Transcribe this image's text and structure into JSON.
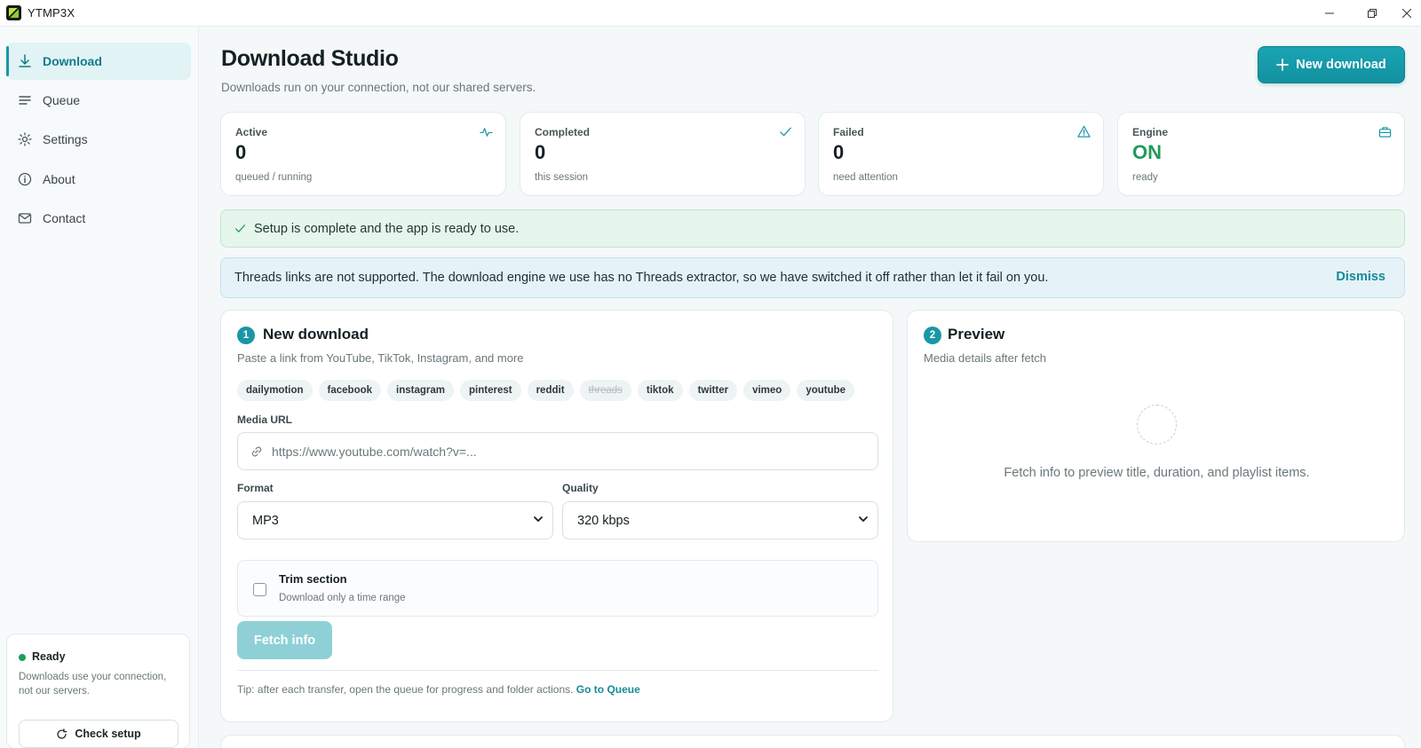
{
  "window": {
    "title": "YTMP3X"
  },
  "sidebar": {
    "items": [
      {
        "label": "Download",
        "icon": "download-icon",
        "active": true
      },
      {
        "label": "Queue",
        "icon": "list-icon"
      },
      {
        "label": "Settings",
        "icon": "gear-icon"
      },
      {
        "label": "About",
        "icon": "info-icon"
      },
      {
        "label": "Contact",
        "icon": "mail-icon"
      }
    ],
    "status": {
      "title": "Ready",
      "text": "Downloads use your connection, not our servers.",
      "button": "Check setup"
    }
  },
  "header": {
    "title": "Download Studio",
    "subtitle": "Downloads run on your connection, not our shared servers.",
    "new_download": "New download"
  },
  "stats": [
    {
      "label": "Active",
      "value": "0",
      "note": "queued / running",
      "icon": "activity-icon"
    },
    {
      "label": "Completed",
      "value": "0",
      "note": "this session",
      "icon": "check-icon"
    },
    {
      "label": "Failed",
      "value": "0",
      "note": "need attention",
      "icon": "warning-icon"
    },
    {
      "label": "Engine",
      "value": "ON",
      "note": "ready",
      "icon": "briefcase-icon"
    }
  ],
  "alerts": {
    "success": "Setup is complete and the app is ready to use.",
    "info": "Threads links are not supported. The download engine we use has no Threads extractor, so we have switched it off rather than let it fail on you.",
    "dismiss": "Dismiss"
  },
  "new_download": {
    "step": "1",
    "title": "New download",
    "subtitle": "Paste a link from YouTube, TikTok, Instagram, and more",
    "platforms": [
      "dailymotion",
      "facebook",
      "instagram",
      "pinterest",
      "reddit",
      "threads",
      "tiktok",
      "twitter",
      "vimeo",
      "youtube"
    ],
    "url_label": "Media URL",
    "url_placeholder": "https://www.youtube.com/watch?v=...",
    "format_label": "Format",
    "format_value": "MP3",
    "quality_label": "Quality",
    "quality_value": "320 kbps",
    "trim_title": "Trim section",
    "trim_sub": "Download only a time range",
    "fetch": "Fetch info",
    "tip": "Tip: after each transfer, open the queue for progress and folder actions.",
    "tip_link": "Go to Queue"
  },
  "preview": {
    "step": "2",
    "title": "Preview",
    "subtitle": "Media details after fetch",
    "empty": "Fetch info to preview title, duration, and playlist items."
  },
  "colors": {
    "accent": "#1a97a6",
    "success": "#1f9c5a"
  }
}
